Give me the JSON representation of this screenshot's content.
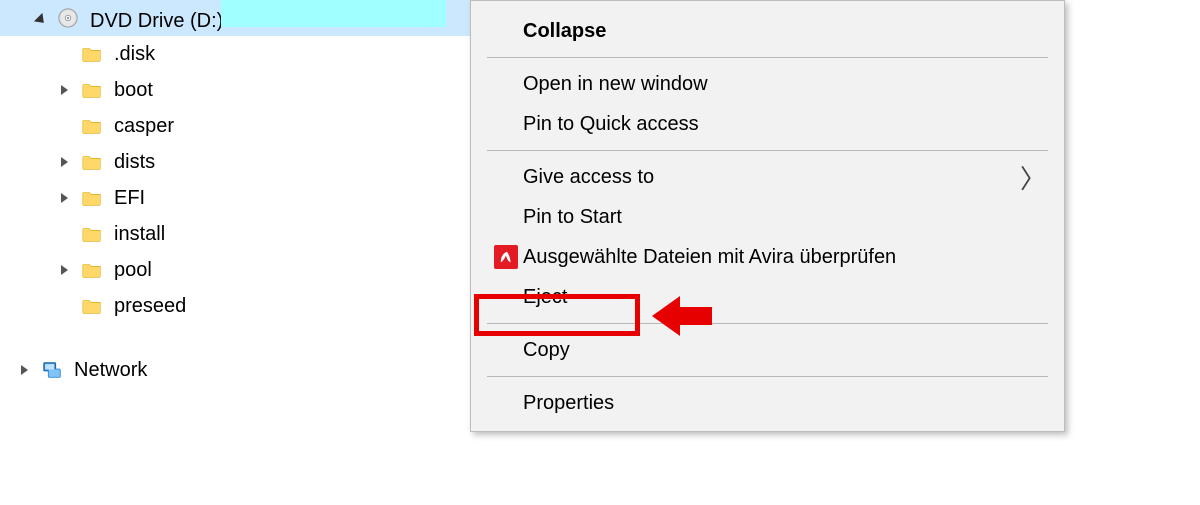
{
  "tree": {
    "drive": {
      "label": "DVD Drive (D:)"
    },
    "children": [
      {
        "label": ".disk",
        "expandable": false
      },
      {
        "label": "boot",
        "expandable": true
      },
      {
        "label": "casper",
        "expandable": false
      },
      {
        "label": "dists",
        "expandable": true
      },
      {
        "label": "EFI",
        "expandable": true
      },
      {
        "label": "install",
        "expandable": false
      },
      {
        "label": "pool",
        "expandable": true
      },
      {
        "label": "preseed",
        "expandable": false
      }
    ],
    "network": {
      "label": "Network"
    }
  },
  "menu": {
    "collapse": "Collapse",
    "open_new_win": "Open in new window",
    "pin_quick": "Pin to Quick access",
    "give_access": "Give access to",
    "pin_start": "Pin to Start",
    "avira_scan": "Ausgewählte Dateien mit Avira überprüfen",
    "eject": "Eject",
    "copy": "Copy",
    "properties": "Properties",
    "submenu_glyph": "〉"
  }
}
